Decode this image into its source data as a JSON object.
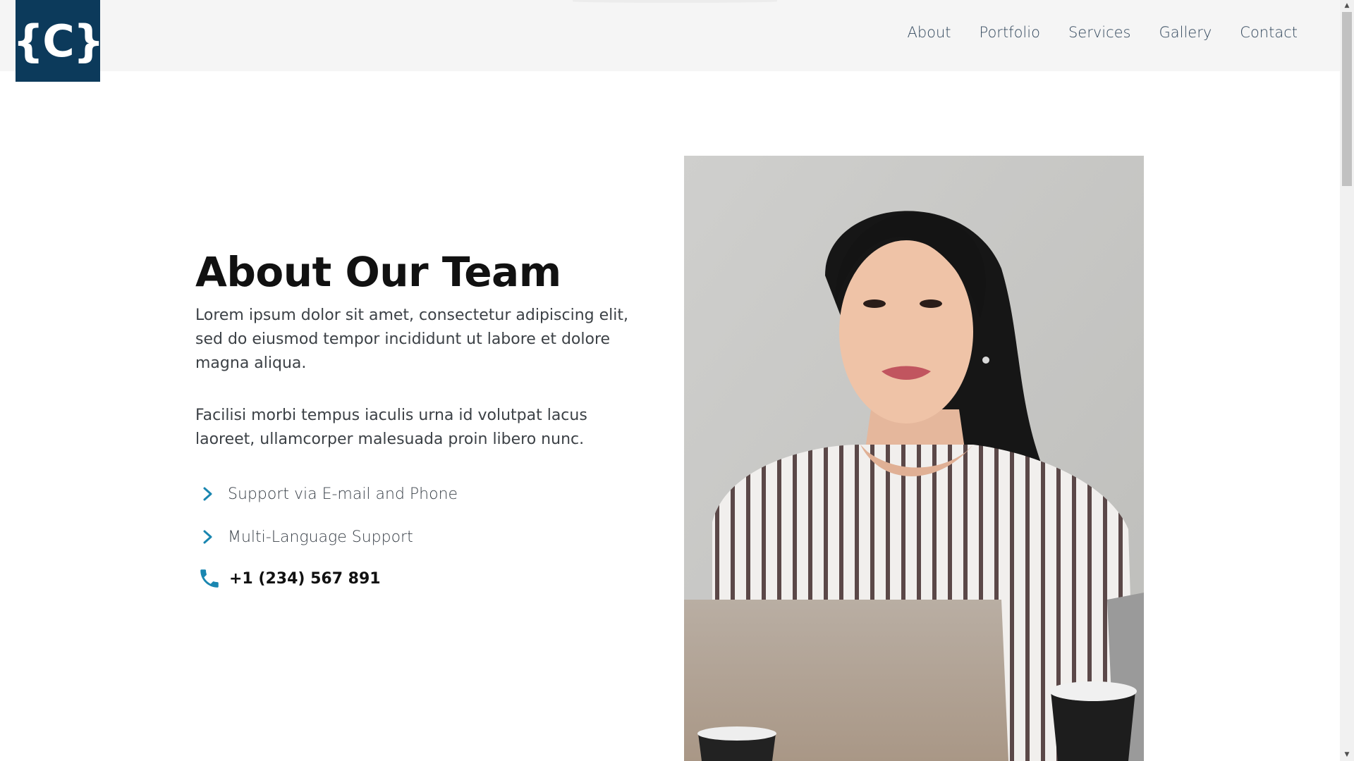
{
  "colors": {
    "header_bg": "#f5f5f5",
    "logo_bg": "#0c3a5b",
    "nav_text": "#34495e",
    "accent": "#1a86b0",
    "heading": "#111111",
    "body_text": "#3c4146"
  },
  "header": {
    "logo_text": "{C}",
    "nav": [
      {
        "label": "About"
      },
      {
        "label": "Portfolio"
      },
      {
        "label": "Services"
      },
      {
        "label": "Gallery"
      },
      {
        "label": "Contact"
      }
    ]
  },
  "about": {
    "title": "About Our Team",
    "paragraph1": "Lorem ipsum dolor sit amet, consectetur adipiscing elit, sed do eiusmod tempor incididunt ut labore et dolore magna aliqua.",
    "paragraph2": "Facilisi morbi tempus iaculis urna id volutpat lacus laoreet, ullamcorper malesuada proin libero nunc.",
    "features": [
      {
        "label": "Support via E-mail and Phone",
        "icon": "chevron-right-icon"
      },
      {
        "label": "Multi-Language Support",
        "icon": "chevron-right-icon"
      }
    ],
    "phone": {
      "number": "+1 (234) 567 891",
      "icon": "phone-icon"
    }
  },
  "photo": {
    "subject": "team-member-photo"
  }
}
